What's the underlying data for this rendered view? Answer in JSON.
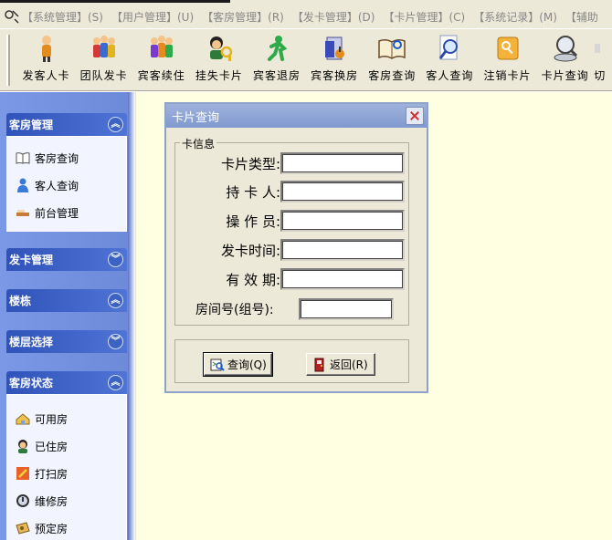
{
  "menubar": {
    "items": [
      "【系统管理】(S)",
      "【用户管理】(U)",
      "【客房管理】(R)",
      "【发卡管理】(D)",
      "【卡片管理】(C)",
      "【系统记录】(M)",
      "【辅助"
    ]
  },
  "toolbar": {
    "buttons": [
      {
        "label": "发客人卡",
        "icon": "single-guest-icon"
      },
      {
        "label": "团队发卡",
        "icon": "group-guests-icon"
      },
      {
        "label": "宾客续住",
        "icon": "guests-extend-icon"
      },
      {
        "label": "挂失卡片",
        "icon": "report-lost-card-icon"
      },
      {
        "label": "宾客退房",
        "icon": "checkout-icon"
      },
      {
        "label": "宾客换房",
        "icon": "change-room-icon"
      },
      {
        "label": "客房查询",
        "icon": "room-book-icon"
      },
      {
        "label": "客人查询",
        "icon": "guest-search-icon"
      },
      {
        "label": "注销卡片",
        "icon": "cancel-card-icon"
      },
      {
        "label": "卡片查询",
        "icon": "card-search-icon"
      },
      {
        "label": "切",
        "icon": "switch-icon"
      }
    ]
  },
  "sidebar": {
    "panels": [
      {
        "title": "客房管理",
        "expanded": true,
        "items": [
          {
            "label": "客房查询",
            "icon": "book-icon"
          },
          {
            "label": "客人查询",
            "icon": "person-icon"
          },
          {
            "label": "前台管理",
            "icon": "desk-icon"
          }
        ]
      },
      {
        "title": "发卡管理",
        "expanded": false,
        "items": []
      },
      {
        "title": "楼栋",
        "expanded": true,
        "items": []
      },
      {
        "title": "楼层选择",
        "expanded": false,
        "items": []
      },
      {
        "title": "客房状态",
        "expanded": true,
        "items": [
          {
            "label": "可用房",
            "icon": "available-room-icon"
          },
          {
            "label": "已住房",
            "icon": "occupied-room-icon"
          },
          {
            "label": "打扫房",
            "icon": "cleaning-room-icon"
          },
          {
            "label": "维修房",
            "icon": "repair-room-icon"
          },
          {
            "label": "预定房",
            "icon": "reserved-room-icon"
          }
        ]
      }
    ]
  },
  "dialog": {
    "title": "卡片查询",
    "group_label": "卡信息",
    "fields": [
      {
        "label": "卡片类型:",
        "value": ""
      },
      {
        "label": "持 卡 人:",
        "value": ""
      },
      {
        "label": "操 作 员:",
        "value": ""
      },
      {
        "label": "发卡时间:",
        "value": ""
      },
      {
        "label": "有 效 期:",
        "value": ""
      },
      {
        "label": "房间号(组号):",
        "value": ""
      }
    ],
    "query_button": "查询(Q)",
    "back_button": "返回(R)"
  },
  "colors": {
    "panel_header": "#3c5fc4",
    "workspace": "#ffffe1",
    "dialog_title": "#8ba1d4"
  }
}
